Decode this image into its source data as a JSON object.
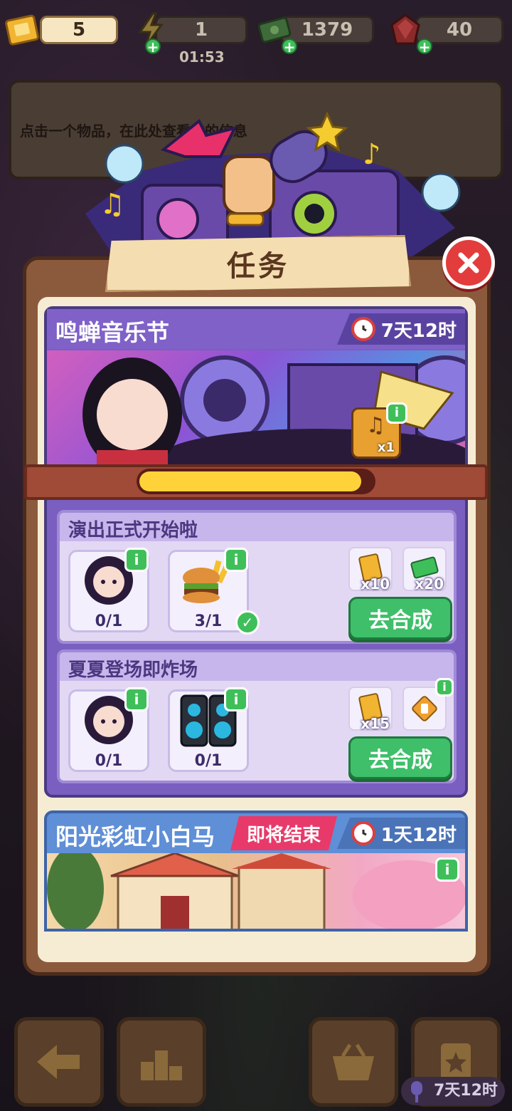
{
  "resources": {
    "tickets": "5",
    "energy": "1",
    "energy_timer": "01:53",
    "cash": "1379",
    "gems": "40"
  },
  "info_box": {
    "hint": "点击一个物品，在此处查看它的信息"
  },
  "panel": {
    "title": "任务"
  },
  "event1": {
    "title": "鸣蝉音乐节",
    "time_left": "7天12时",
    "chest_count": "x1",
    "progress": 0.95,
    "tasks": [
      {
        "title": "演出正式开始啦",
        "items": [
          {
            "icon": "idol-character-icon",
            "count": "0/1"
          },
          {
            "icon": "burger-fries-icon",
            "count": "3/1",
            "done": true
          }
        ],
        "rewards": [
          {
            "icon": "ticket-icon",
            "amount": "x10"
          },
          {
            "icon": "cash-icon",
            "amount": "x20"
          }
        ],
        "button": "去合成"
      },
      {
        "title": "夏夏登场即炸场",
        "items": [
          {
            "icon": "idol-character-icon",
            "count": "0/1"
          },
          {
            "icon": "speakers-icon",
            "count": "0/1"
          }
        ],
        "rewards": [
          {
            "icon": "ticket-icon",
            "amount": "x15"
          },
          {
            "icon": "mystery-item-icon",
            "amount": ""
          }
        ],
        "button": "去合成"
      }
    ]
  },
  "event2": {
    "title": "阳光彩虹小白马",
    "tag": "即将结束",
    "time_left": "1天12时"
  },
  "bottom": {
    "timer": "7天12时"
  }
}
